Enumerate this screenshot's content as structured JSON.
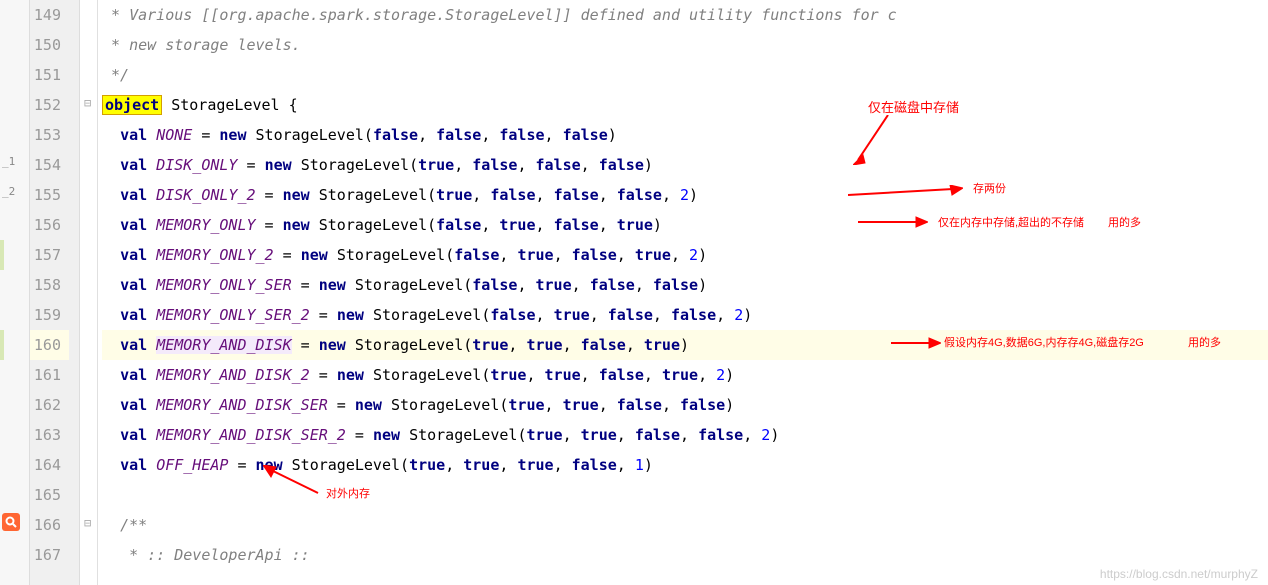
{
  "gutter": {
    "start": 149,
    "end": 167
  },
  "markers": {
    "marker1": "_1",
    "marker2": "_2"
  },
  "lines": {
    "l149": " * Various [[org.apache.spark.storage.StorageLevel]] defined and utility functions for c",
    "l150": " * new storage levels.",
    "l151": " */",
    "l152_kw": "object",
    "l152_rest": " StorageLevel {",
    "val_kw": "val",
    "new_kw": "new",
    "cls": "StorageLevel",
    "names": {
      "NONE": "NONE",
      "DISK_ONLY": "DISK_ONLY",
      "DISK_ONLY_2": "DISK_ONLY_2",
      "MEMORY_ONLY": "MEMORY_ONLY",
      "MEMORY_ONLY_2": "MEMORY_ONLY_2",
      "MEMORY_ONLY_SER": "MEMORY_ONLY_SER",
      "MEMORY_ONLY_SER_2": "MEMORY_ONLY_SER_2",
      "MEMORY_AND_DISK": "MEMORY_AND_DISK",
      "MEMORY_AND_DISK_2": "MEMORY_AND_DISK_2",
      "MEMORY_AND_DISK_SER": "MEMORY_AND_DISK_SER",
      "MEMORY_AND_DISK_SER_2": "MEMORY_AND_DISK_SER_2",
      "OFF_HEAP": "OFF_HEAP"
    },
    "true": "true",
    "false": "false",
    "two": "2",
    "one": "1",
    "l166": "/**",
    "l167": " * :: DeveloperApi ::"
  },
  "annotations": {
    "disk_only": "仅在磁盘中存储",
    "two_copies": "存两份",
    "memory_only": "仅在内存中存储,超出的不存储",
    "memory_only_suffix": "用的多",
    "memory_and_disk": "假设内存4G,数据6G,内存存4G,磁盘存2G",
    "memory_and_disk_suffix": "用的多",
    "off_heap": "对外内存"
  },
  "watermark": "https://blog.csdn.net/murphyZ"
}
